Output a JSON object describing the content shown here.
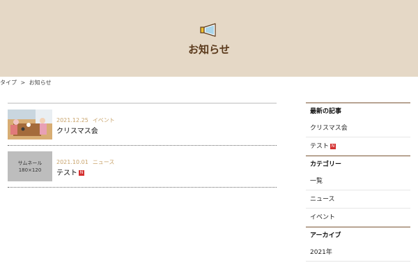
{
  "hero": {
    "title": "お知らせ",
    "icon": "megaphone-icon"
  },
  "breadcrumb": {
    "items": [
      "タイプ",
      ">",
      "お知らせ"
    ]
  },
  "posts": [
    {
      "date": "2021.12.25",
      "category": "イベント",
      "title": "クリスマス会",
      "thumb_type": "photo",
      "new": false
    },
    {
      "date": "2021.10.01",
      "category": "ニュース",
      "title": "テスト",
      "thumb_type": "placeholder",
      "thumb_line1": "サムネール",
      "thumb_line2": "180×120",
      "new": true
    }
  ],
  "sidebar": {
    "latest": {
      "heading": "最新の記事",
      "items": [
        "クリスマス会",
        "テスト"
      ]
    },
    "categories": {
      "heading": "カテゴリー",
      "items": [
        "一覧",
        "ニュース",
        "イベント"
      ]
    },
    "archive": {
      "heading": "アーカイブ",
      "items": [
        "2021年"
      ]
    }
  },
  "colors": {
    "hero_bg": "#e5d8c6",
    "title": "#5b3a1c",
    "meta": "#c9a46c",
    "badge": "#d43030",
    "divider": "#7a5534"
  }
}
